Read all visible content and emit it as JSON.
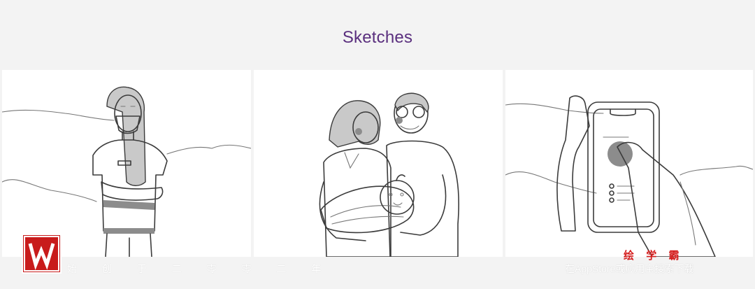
{
  "page": {
    "title": "Sketches"
  },
  "gallery": [
    {
      "subject": "masked-worker-arms-crossed"
    },
    {
      "subject": "family-with-baby"
    },
    {
      "subject": "hand-holding-phone"
    }
  ],
  "watermark": {
    "brand": "绘 学 霸",
    "slogan": "始 创 于 二 零 零 二 年",
    "store_text": "在AppStore或应用宝搜索下载",
    "logo_letter": "W",
    "colors": {
      "logo": "#c81b1b",
      "title": "#5a2f7e"
    }
  }
}
